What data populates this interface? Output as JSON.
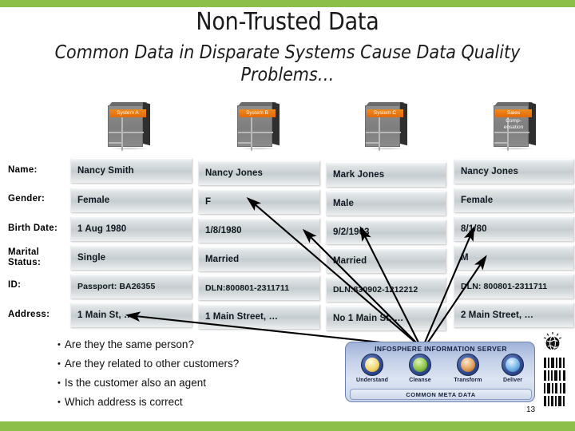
{
  "slide": {
    "title": "Non-Trusted Data",
    "subtitle": "Common Data in Disparate Systems Cause Data Quality Problems…",
    "page_number": "13",
    "accent_green": "#8cbe4a",
    "accent_orange": "#e2690a"
  },
  "systems": [
    {
      "id": "system-a",
      "label": "System A",
      "sublabel": ""
    },
    {
      "id": "system-b",
      "label": "System B",
      "sublabel": ""
    },
    {
      "id": "system-c",
      "label": "System C",
      "sublabel": ""
    },
    {
      "id": "sales-compensation",
      "label": "Sales",
      "sublabel": "Comp-\nensation"
    }
  ],
  "row_labels": [
    "Name:",
    "Gender:",
    "Birth Date:",
    "Marital\nStatus:",
    "ID:",
    "Address:"
  ],
  "rows": [
    {
      "label": "Name:",
      "cells": [
        "Nancy Smith",
        "Nancy Jones",
        "Mark Jones",
        "Nancy Jones"
      ]
    },
    {
      "label": "Gender:",
      "cells": [
        "Female",
        "F",
        "Male",
        "Female"
      ]
    },
    {
      "label": "Birth Date:",
      "cells": [
        "1 Aug 1980",
        "1/8/1980",
        "9/2/1963",
        "8/1/80"
      ]
    },
    {
      "label": "Marital Status:",
      "cells": [
        "Single",
        "Married",
        "Married",
        "M"
      ]
    },
    {
      "label": "ID:",
      "cells": [
        "Passport: BA26355",
        "DLN:800801-2311711",
        "DLN:830902-1212212",
        "DLN: 800801-2311711"
      ]
    },
    {
      "label": "Address:",
      "cells": [
        "1 Main St, …",
        "1 Main Street, …",
        "No 1 Main St, …",
        "2 Main Street, …"
      ]
    }
  ],
  "bullets": [
    "Are they the same person?",
    "Are they related to other customers?",
    "Is the customer also an agent",
    "Which address is correct"
  ],
  "infosphere": {
    "title": "INFOSPHERE INFORMATION SERVER",
    "footer": "COMMON META DATA",
    "items": [
      {
        "label": "Understand",
        "icon": "lightbulb-icon"
      },
      {
        "label": "Cleanse",
        "icon": "globe-icon"
      },
      {
        "label": "Transform",
        "icon": "paintbrush-icon"
      },
      {
        "label": "Deliver",
        "icon": "starburst-icon"
      }
    ]
  }
}
